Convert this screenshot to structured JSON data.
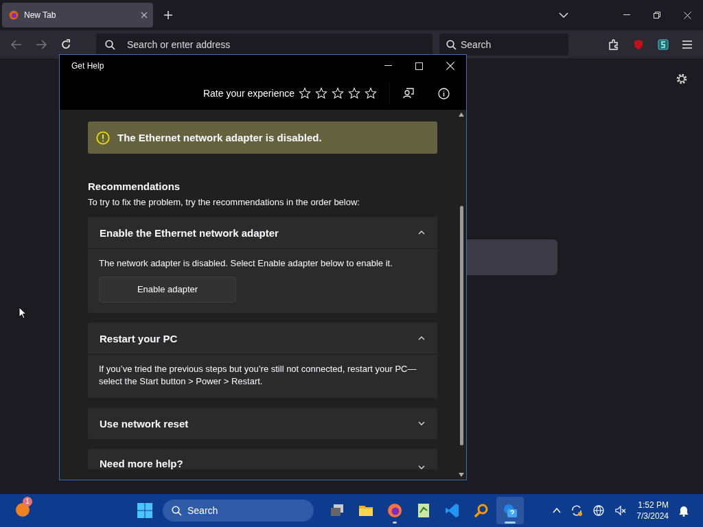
{
  "browser": {
    "tab": {
      "title": "New Tab",
      "selected": true
    },
    "address": {
      "placeholder": "Search or enter address"
    },
    "search": {
      "placeholder": "Search"
    }
  },
  "help_window": {
    "title": "Get Help",
    "rating": {
      "label": "Rate your experience",
      "stars": 0
    },
    "alert": "The Ethernet network adapter is disabled.",
    "recommendations": {
      "heading": "Recommendations",
      "intro": "To try to fix the problem, try the recommendations in the order below:"
    },
    "sections": [
      {
        "title": "Enable the Ethernet network adapter",
        "expanded": true,
        "body": "The network adapter is disabled. Select Enable adapter below to enable it.",
        "button": "Enable adapter"
      },
      {
        "title": "Restart your PC",
        "expanded": true,
        "body": "If you’ve tried the previous steps but you’re still not connected, restart your PC—select the Start button > Power > Restart."
      },
      {
        "title": "Use network reset",
        "expanded": false
      },
      {
        "title": "Need more help?",
        "expanded": false
      }
    ]
  },
  "taskbar": {
    "badge": "1",
    "search": {
      "placeholder": "Search"
    },
    "apps": [
      {
        "kind": "taskview",
        "active": false,
        "running": false
      },
      {
        "kind": "files",
        "active": false,
        "running": false
      },
      {
        "kind": "firefox",
        "active": false,
        "running": true
      },
      {
        "kind": "notepad",
        "active": false,
        "running": false
      },
      {
        "kind": "vscode",
        "active": false,
        "running": false
      },
      {
        "kind": "magnifier",
        "active": false,
        "running": false
      },
      {
        "kind": "help",
        "active": true,
        "running": true
      }
    ],
    "time": "1:52 PM",
    "date": "7/3/2024"
  }
}
